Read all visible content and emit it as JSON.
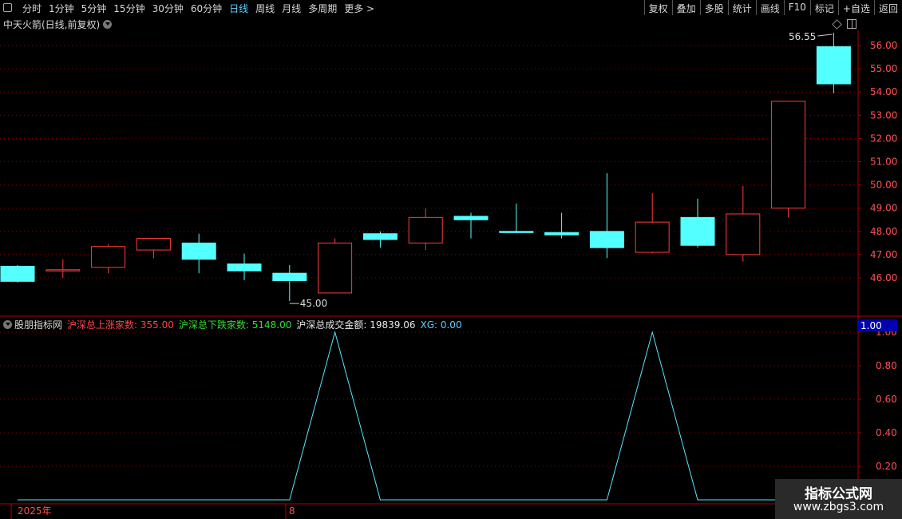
{
  "toolbar": {
    "tabs": [
      "分时",
      "1分钟",
      "5分钟",
      "15分钟",
      "30分钟",
      "60分钟",
      "日线",
      "周线",
      "月线",
      "多周期",
      "更多 >"
    ],
    "active_tab": "日线",
    "right_buttons": [
      "复权",
      "叠加",
      "多股",
      "统计",
      "画线",
      "F10",
      "标记",
      "+自选",
      "返回"
    ]
  },
  "title": "中天火箭(日线,前复权)",
  "indicator": {
    "name": "股朋指标网",
    "items": [
      {
        "label": "沪深总上涨家数: 355.00",
        "color": "#ff4444"
      },
      {
        "label": "沪深总下跌家数: 5148.00",
        "color": "#33dd33"
      },
      {
        "label": "沪深总成交金额: 19839.06",
        "color": "#e8e8e8"
      },
      {
        "label": "XG: 0.00",
        "color": "#5cd0ff"
      }
    ],
    "current_value": "1.00"
  },
  "chart_data": [
    {
      "type": "candlestick",
      "title": "中天火箭(日线,前复权)",
      "ylim": [
        45.0,
        56.55
      ],
      "y_ticks": [
        "46.00",
        "47.00",
        "48.00",
        "49.00",
        "50.00",
        "51.00",
        "52.00",
        "53.00",
        "54.00",
        "55.00",
        "56.00"
      ],
      "annotations": {
        "max": "56.55",
        "min": "45.00"
      },
      "candles": [
        {
          "open": 46.5,
          "close": 45.85,
          "high": 46.55,
          "low": 45.8
        },
        {
          "open": 46.3,
          "close": 46.35,
          "high": 46.8,
          "low": 46.0
        },
        {
          "open": 46.45,
          "close": 47.35,
          "high": 47.45,
          "low": 46.2
        },
        {
          "open": 47.2,
          "close": 47.7,
          "high": 47.72,
          "low": 46.85
        },
        {
          "open": 47.5,
          "close": 46.8,
          "high": 47.9,
          "low": 46.2
        },
        {
          "open": 46.6,
          "close": 46.3,
          "high": 47.05,
          "low": 45.9
        },
        {
          "open": 46.2,
          "close": 45.88,
          "high": 46.55,
          "low": 45.0
        },
        {
          "open": 45.35,
          "close": 47.5,
          "high": 47.7,
          "low": 45.35
        },
        {
          "open": 47.9,
          "close": 47.65,
          "high": 48.0,
          "low": 47.3
        },
        {
          "open": 47.5,
          "close": 48.6,
          "high": 49.0,
          "low": 47.2
        },
        {
          "open": 48.65,
          "close": 48.5,
          "high": 48.8,
          "low": 47.7
        },
        {
          "open": 48.0,
          "close": 47.95,
          "high": 49.2,
          "low": 47.95
        },
        {
          "open": 47.95,
          "close": 47.85,
          "high": 48.8,
          "low": 47.7
        },
        {
          "open": 48.0,
          "close": 47.3,
          "high": 50.5,
          "low": 46.85
        },
        {
          "open": 47.1,
          "close": 48.4,
          "high": 49.65,
          "low": 47.05
        },
        {
          "open": 48.6,
          "close": 47.4,
          "high": 49.4,
          "low": 47.3
        },
        {
          "open": 47.0,
          "close": 48.75,
          "high": 49.95,
          "low": 46.7
        },
        {
          "open": 49.0,
          "close": 53.6,
          "high": 53.6,
          "low": 48.6
        },
        {
          "open": 55.95,
          "close": 54.35,
          "high": 56.55,
          "low": 53.95
        }
      ]
    },
    {
      "type": "line",
      "series": [
        {
          "values": [
            0,
            0,
            0,
            0,
            0,
            0,
            0,
            1,
            0,
            0,
            0,
            0,
            0,
            0,
            1,
            0,
            0,
            0,
            0
          ]
        }
      ],
      "ylim": [
        0,
        1
      ],
      "y_ticks": [
        "0.20",
        "0.40",
        "0.60",
        "0.80",
        "1.00"
      ],
      "x_labels": [
        "2025年",
        "8"
      ]
    }
  ],
  "watermark": {
    "line1": "指标公式网",
    "line2": "www.zbgs3.com"
  },
  "colors": {
    "up": "#ff3c3c",
    "down": "#54ffff",
    "grid": "#8b0000",
    "axis": "#b00000",
    "line": "#54e8ff"
  }
}
